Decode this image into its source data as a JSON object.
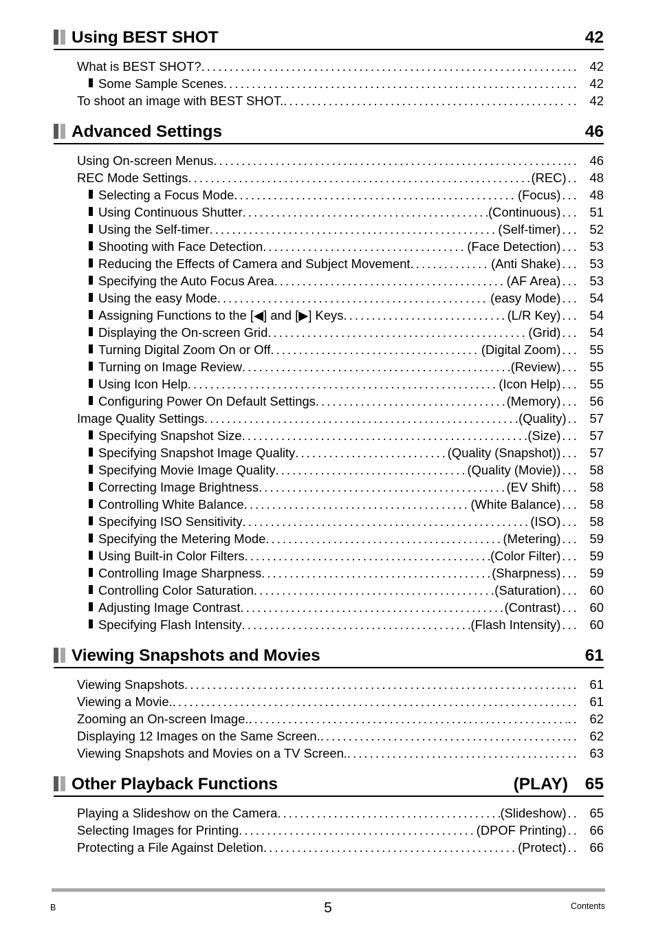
{
  "document": {
    "type": "table-of-contents",
    "footer": {
      "left": "B",
      "page_number": "5",
      "right": "Contents"
    }
  },
  "sections": [
    {
      "title": "Using BEST SHOT",
      "tag": "",
      "page": "42",
      "entries": [
        {
          "level": 1,
          "title": "What is BEST SHOT?",
          "tag": "",
          "page": "42"
        },
        {
          "level": 2,
          "title": "Some Sample Scenes",
          "tag": "",
          "page": "42"
        },
        {
          "level": 1,
          "title": "To shoot an image with BEST SHOT.",
          "tag": "",
          "page": "42"
        }
      ]
    },
    {
      "title": "Advanced Settings",
      "tag": "",
      "page": "46",
      "entries": [
        {
          "level": 1,
          "title": "Using On-screen Menus",
          "tag": "",
          "page": "46"
        },
        {
          "level": 1,
          "title": "REC Mode Settings",
          "tag": "(REC)",
          "page": "48"
        },
        {
          "level": 2,
          "title": "Selecting a Focus Mode",
          "tag": "(Focus)",
          "page": "48"
        },
        {
          "level": 2,
          "title": "Using Continuous Shutter",
          "tag": "(Continuous)",
          "page": "51"
        },
        {
          "level": 2,
          "title": "Using the Self-timer",
          "tag": "(Self-timer)",
          "page": "52"
        },
        {
          "level": 2,
          "title": "Shooting with Face Detection",
          "tag": "(Face Detection)",
          "page": "53"
        },
        {
          "level": 2,
          "title": "Reducing the Effects of Camera and Subject Movement",
          "tag": "(Anti Shake)",
          "page": "53"
        },
        {
          "level": 2,
          "title": "Specifying the Auto Focus Area",
          "tag": "(AF Area)",
          "page": "53"
        },
        {
          "level": 2,
          "title": "Using the easy Mode",
          "tag": "(easy Mode)",
          "page": "54"
        },
        {
          "level": 2,
          "title": "Assigning Functions to the [◀] and [▶] Keys",
          "tag": "(L/R Key)",
          "page": "54"
        },
        {
          "level": 2,
          "title": "Displaying the On-screen Grid",
          "tag": "(Grid)",
          "page": "54"
        },
        {
          "level": 2,
          "title": "Turning Digital Zoom On or Off",
          "tag": "(Digital Zoom)",
          "page": "55"
        },
        {
          "level": 2,
          "title": "Turning on Image Review",
          "tag": "(Review)",
          "page": "55"
        },
        {
          "level": 2,
          "title": "Using Icon Help",
          "tag": "(Icon Help)",
          "page": "55"
        },
        {
          "level": 2,
          "title": "Configuring Power On Default Settings",
          "tag": "(Memory)",
          "page": "56"
        },
        {
          "level": 1,
          "title": "Image Quality Settings",
          "tag": "(Quality)",
          "page": "57"
        },
        {
          "level": 2,
          "title": "Specifying Snapshot Size",
          "tag": "(Size)",
          "page": "57"
        },
        {
          "level": 2,
          "title": "Specifying Snapshot Image Quality",
          "tag": "(Quality (Snapshot))",
          "page": "57"
        },
        {
          "level": 2,
          "title": "Specifying Movie Image Quality",
          "tag": "(Quality (Movie))",
          "page": "58"
        },
        {
          "level": 2,
          "title": "Correcting Image Brightness",
          "tag": "(EV Shift)",
          "page": "58"
        },
        {
          "level": 2,
          "title": "Controlling White Balance",
          "tag": "(White Balance)",
          "page": "58"
        },
        {
          "level": 2,
          "title": "Specifying ISO Sensitivity",
          "tag": "(ISO)",
          "page": "58"
        },
        {
          "level": 2,
          "title": "Specifying the Metering Mode",
          "tag": "(Metering)",
          "page": "59"
        },
        {
          "level": 2,
          "title": "Using Built-in Color Filters",
          "tag": "(Color Filter)",
          "page": "59"
        },
        {
          "level": 2,
          "title": "Controlling Image Sharpness",
          "tag": "(Sharpness)",
          "page": "59"
        },
        {
          "level": 2,
          "title": "Controlling Color Saturation",
          "tag": "(Saturation)",
          "page": "60"
        },
        {
          "level": 2,
          "title": "Adjusting Image Contrast",
          "tag": "(Contrast)",
          "page": "60"
        },
        {
          "level": 2,
          "title": "Specifying Flash Intensity",
          "tag": "(Flash Intensity)",
          "page": "60"
        }
      ]
    },
    {
      "title": "Viewing Snapshots and Movies",
      "tag": "",
      "page": "61",
      "entries": [
        {
          "level": 1,
          "title": "Viewing Snapshots",
          "tag": "",
          "page": "61"
        },
        {
          "level": 1,
          "title": "Viewing a Movie.",
          "tag": "",
          "page": "61"
        },
        {
          "level": 1,
          "title": "Zooming an On-screen Image.",
          "tag": "",
          "page": "62"
        },
        {
          "level": 1,
          "title": "Displaying 12 Images on the Same Screen.",
          "tag": "",
          "page": "62"
        },
        {
          "level": 1,
          "title": "Viewing Snapshots and Movies on a TV Screen.",
          "tag": "",
          "page": "63"
        }
      ]
    },
    {
      "title": "Other Playback Functions",
      "tag": "(PLAY)",
      "page": "65",
      "entries": [
        {
          "level": 1,
          "title": "Playing a Slideshow on the Camera",
          "tag": "(Slideshow)",
          "page": "65"
        },
        {
          "level": 1,
          "title": "Selecting Images for Printing",
          "tag": "(DPOF Printing)",
          "page": "66"
        },
        {
          "level": 1,
          "title": "Protecting a File Against Deletion",
          "tag": "(Protect)",
          "page": "66"
        }
      ]
    }
  ]
}
